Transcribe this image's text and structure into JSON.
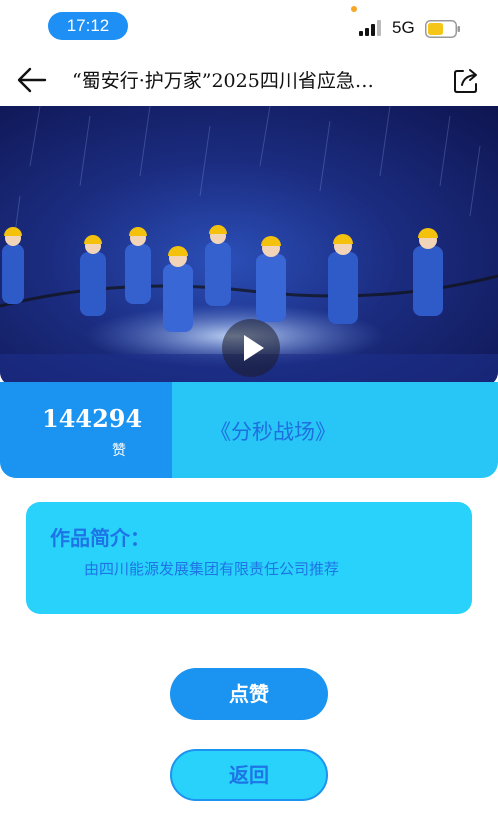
{
  "status_bar": {
    "time": "17:12",
    "network": "5G",
    "battery_color": "#f5c518",
    "icons": [
      "signal-icon",
      "battery-icon"
    ]
  },
  "header": {
    "back_icon": "arrow-left-icon",
    "title": "“蜀安行·护万家”2025四川省应急…",
    "share_icon": "share-icon"
  },
  "video": {
    "play_icon": "play-icon"
  },
  "work": {
    "likes": "144294",
    "likes_unit": "赞",
    "title": "《分秒战场》"
  },
  "intro": {
    "heading": "作品简介：",
    "text": "由四川能源发展集团有限责任公司推荐"
  },
  "actions": {
    "like_label": "点赞",
    "back_label": "返回"
  },
  "colors": {
    "primary_blue": "#1b93f0",
    "light_cyan": "#29d2fb",
    "text_blue": "#1e74e6"
  }
}
